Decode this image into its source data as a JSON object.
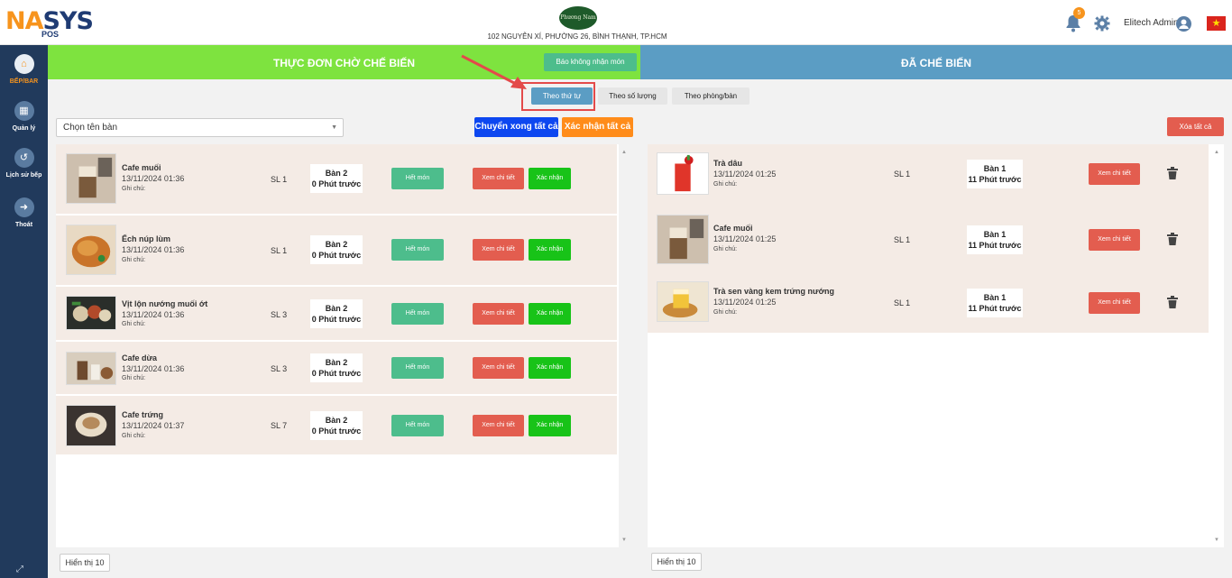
{
  "brand": {
    "logo_big_a": "NA",
    "logo_big_b": "SYS",
    "logo_sub": "POS",
    "restaurant_logo": "Phương Nam",
    "address": "102 NGUYỄN XÍ, PHƯỜNG 26, BÌNH THẠNH, TP.HCM"
  },
  "topbar": {
    "notification_count": "5",
    "username": "Elitech Admin"
  },
  "sidebar": {
    "items": [
      {
        "label": "BẾP/BAR"
      },
      {
        "label": "Quản lý"
      },
      {
        "label": "Lịch sử bếp"
      },
      {
        "label": "Thoát"
      }
    ]
  },
  "headers": {
    "pending_title": "THỰC ĐƠN CHỜ CHẾ BIẾN",
    "report_button": "Báo không nhận món",
    "done_title": "ĐÃ CHẾ BIẾN"
  },
  "tabs": [
    {
      "label": "Theo thứ tự"
    },
    {
      "label": "Theo số lượng"
    },
    {
      "label": "Theo phòng/bàn"
    }
  ],
  "toolbar": {
    "select_placeholder": "Chọn tên bàn",
    "done_all": "Chuyển xong tất cả",
    "confirm_all": "Xác nhận tất cả",
    "clear_all": "Xóa tất cả"
  },
  "labels": {
    "out_of_stock": "Hết món",
    "view_detail": "Xem chi tiết",
    "confirm": "Xác nhận",
    "note": "Ghi chú:"
  },
  "pending": [
    {
      "name": "Cafe muối",
      "time": "13/11/2024 01:36",
      "qty": "SL 1",
      "table": "Bàn 2",
      "ago": "0 Phút trước"
    },
    {
      "name": "Ếch núp lùm",
      "time": "13/11/2024 01:36",
      "qty": "SL 1",
      "table": "Bàn 2",
      "ago": "0 Phút trước"
    },
    {
      "name": "Vịt lộn nướng muối ớt",
      "time": "13/11/2024 01:36",
      "qty": "SL 3",
      "table": "Bàn 2",
      "ago": "0 Phút trước"
    },
    {
      "name": "Cafe dừa",
      "time": "13/11/2024 01:36",
      "qty": "SL 3",
      "table": "Bàn 2",
      "ago": "0 Phút trước"
    },
    {
      "name": "Cafe trứng",
      "time": "13/11/2024 01:37",
      "qty": "SL 7",
      "table": "Bàn 2",
      "ago": "0 Phút trước"
    }
  ],
  "done": [
    {
      "name": "Trà dâu",
      "time": "13/11/2024 01:25",
      "qty": "SL 1",
      "table": "Bàn 1",
      "ago": "11 Phút trước"
    },
    {
      "name": "Cafe muối",
      "time": "13/11/2024 01:25",
      "qty": "SL 1",
      "table": "Bàn 1",
      "ago": "11 Phút trước"
    },
    {
      "name": "Trà sen vàng kem trứng nướng",
      "time": "13/11/2024 01:25",
      "qty": "SL 1",
      "table": "Bàn 1",
      "ago": "11 Phút trước"
    }
  ],
  "pagination": {
    "left": "Hiển thị 10",
    "right": "Hiển thị 10"
  },
  "colors": {
    "pending_header": "#7ee33f",
    "done_header": "#5b9dc4",
    "sidebar": "#213a5c",
    "accent": "#f7941d"
  }
}
